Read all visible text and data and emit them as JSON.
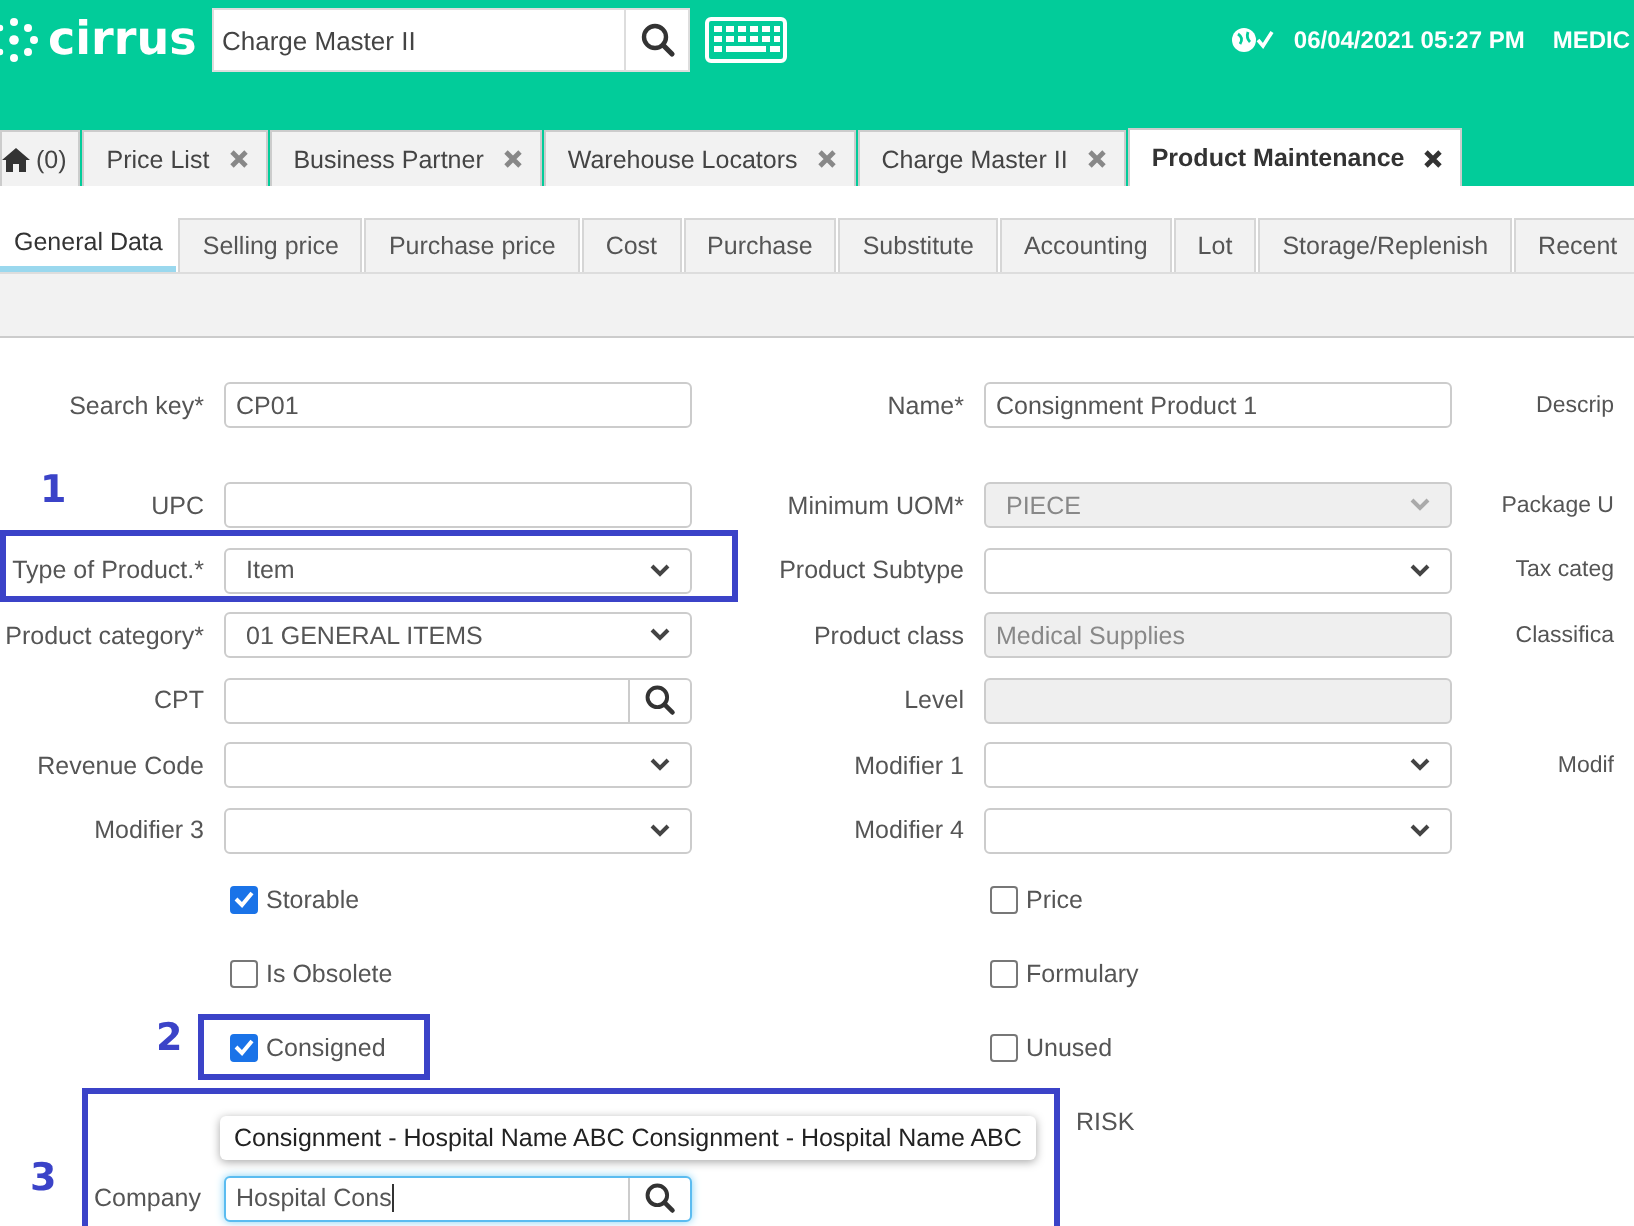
{
  "header": {
    "logo": "cirrus",
    "search": {
      "value": "Charge Master II"
    },
    "datetime": "06/04/2021 05:27 PM",
    "user": "MEDIC"
  },
  "window_tabs": [
    {
      "label": "(0)",
      "kind": "home",
      "selected": false,
      "closable": false
    },
    {
      "label": "Price List",
      "kind": "tab",
      "selected": false,
      "closable": true
    },
    {
      "label": "Business Partner",
      "kind": "tab",
      "selected": false,
      "closable": true
    },
    {
      "label": "Warehouse Locators",
      "kind": "tab",
      "selected": false,
      "closable": true
    },
    {
      "label": "Charge Master II",
      "kind": "tab",
      "selected": false,
      "closable": true
    },
    {
      "label": "Product Maintenance",
      "kind": "tab",
      "selected": true,
      "closable": true
    }
  ],
  "subtabs": [
    {
      "label": "General Data",
      "selected": true
    },
    {
      "label": "Selling price",
      "selected": false
    },
    {
      "label": "Purchase price",
      "selected": false
    },
    {
      "label": "Cost",
      "selected": false
    },
    {
      "label": "Purchase",
      "selected": false
    },
    {
      "label": "Substitute",
      "selected": false
    },
    {
      "label": "Accounting",
      "selected": false
    },
    {
      "label": "Lot",
      "selected": false
    },
    {
      "label": "Storage/Replenish",
      "selected": false
    },
    {
      "label": "Recent",
      "selected": false
    }
  ],
  "form_groups": [
    {
      "rows": [
        {
          "fields": [
            {
              "label": "Search key*",
              "kind": "text",
              "value": "CP01",
              "disabled": false
            },
            {
              "label": "Name*",
              "kind": "text",
              "value": "Consignment Product 1",
              "disabled": false
            }
          ],
          "right_label": "Descrip"
        }
      ]
    },
    {
      "rows": [
        {
          "fields": [
            {
              "label": "UPC",
              "kind": "text",
              "disabled": false
            },
            {
              "label": "Minimum UOM*",
              "kind": "select",
              "value": "PIECE",
              "disabled": true
            }
          ],
          "right_label": "Package U"
        },
        {
          "fields": [
            {
              "label": "Type of Product.*",
              "kind": "select",
              "value": "Item",
              "disabled": false
            },
            {
              "label": "Product Subtype",
              "kind": "select",
              "disabled": false
            }
          ],
          "right_label": "Tax categ"
        },
        {
          "fields": [
            {
              "label": "Product category*",
              "kind": "select",
              "value": "01 GENERAL ITEMS",
              "disabled": false
            },
            {
              "label": "Product class",
              "kind": "text",
              "value": "Medical Supplies",
              "disabled": true
            }
          ],
          "right_label": "Classifica"
        },
        {
          "fields": [
            {
              "label": "CPT",
              "kind": "lookup",
              "disabled": false
            },
            {
              "label": "Level",
              "kind": "text",
              "disabled": true
            }
          ]
        },
        {
          "fields": [
            {
              "label": "Revenue Code",
              "kind": "select",
              "disabled": false
            },
            {
              "label": "Modifier 1",
              "kind": "select",
              "disabled": false
            }
          ],
          "right_label": "Modif"
        },
        {
          "fields": [
            {
              "label": "Modifier 3",
              "kind": "select",
              "disabled": false
            },
            {
              "label": "Modifier 4",
              "kind": "select",
              "disabled": false
            }
          ]
        }
      ]
    }
  ],
  "checkbox_rows": [
    {
      "left": {
        "label": "Storable",
        "checked": true
      },
      "right": {
        "label": "Price",
        "checked": false
      }
    },
    {
      "left": {
        "label": "Is Obsolete",
        "checked": false
      },
      "right": {
        "label": "Formulary",
        "checked": false
      }
    },
    {
      "left": {
        "label": "Consigned",
        "checked": true
      },
      "right": {
        "label": "Unused",
        "checked": false
      }
    },
    {
      "right": {
        "label": "RISK"
      }
    }
  ],
  "company": {
    "label": "Company",
    "value": "Hospital Cons",
    "suggestion": "Consignment - Hospital Name ABC Consignment - Hospital Name ABC"
  },
  "annotations": [
    {
      "number": "1"
    },
    {
      "number": "2"
    },
    {
      "number": "3"
    }
  ]
}
